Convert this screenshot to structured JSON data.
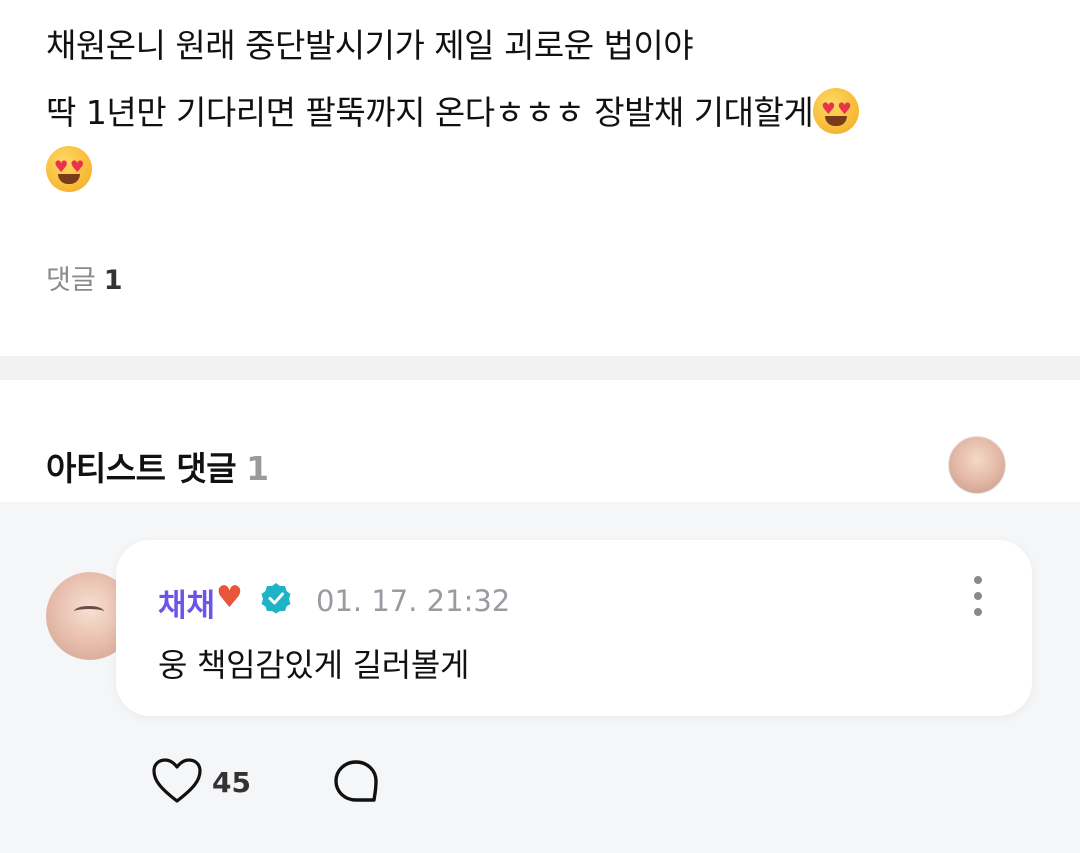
{
  "post": {
    "line1": "채원온니 원래 중단발시기가 제일 괴로운 법이야",
    "line2": "딱 1년만 기다리면 팔뚝까지 온다ㅎㅎㅎ 장발채 기대할게",
    "emoji_icon": "heart-eyes-emoji",
    "comment_label": "댓글",
    "comment_count": "1"
  },
  "artist_comments": {
    "title": "아티스트 댓글",
    "count": "1"
  },
  "comment": {
    "author": "채채",
    "author_color": "#6a55e8",
    "author_emoji": "orange-heart",
    "verified_icon": "verified-badge-icon",
    "verified_color": "#1fb3c6",
    "timestamp": "01. 17. 21:32",
    "text": "웅 책임감있게 길러볼게",
    "like_count": "45"
  }
}
